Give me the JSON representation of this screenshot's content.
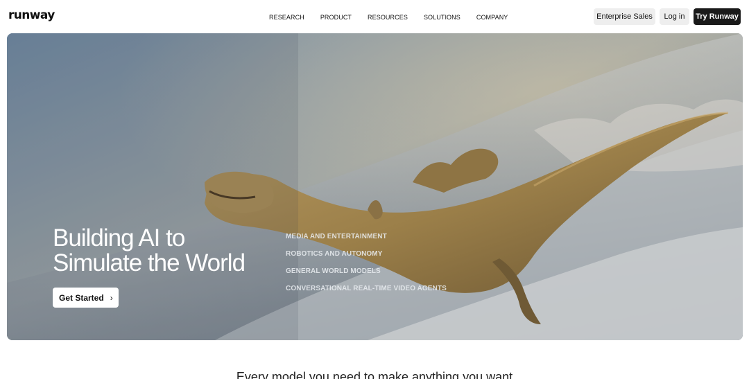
{
  "header": {
    "logo": "runway",
    "nav": [
      "RESEARCH",
      "PRODUCT",
      "RESOURCES",
      "SOLUTIONS",
      "COMPANY"
    ],
    "enterprise_label": "Enterprise Sales",
    "login_label": "Log in",
    "try_label": "Try Runway"
  },
  "hero": {
    "title_line1": "Building AI to",
    "title_line2": "Simulate the World",
    "cta_label": "Get Started",
    "cta_icon": "chevron-right-icon",
    "solutions": [
      "MEDIA AND ENTERTAINMENT",
      "ROBOTICS AND AUTONOMY",
      "GENERAL WORLD MODELS",
      "CONVERSATIONAL REAL-TIME VIDEO AGENTS"
    ]
  },
  "section": {
    "heading": "Every model you need to make anything you want"
  },
  "colors": {
    "try_button_bg": "#1a1a1a",
    "secondary_button_bg": "#eeeeee"
  }
}
